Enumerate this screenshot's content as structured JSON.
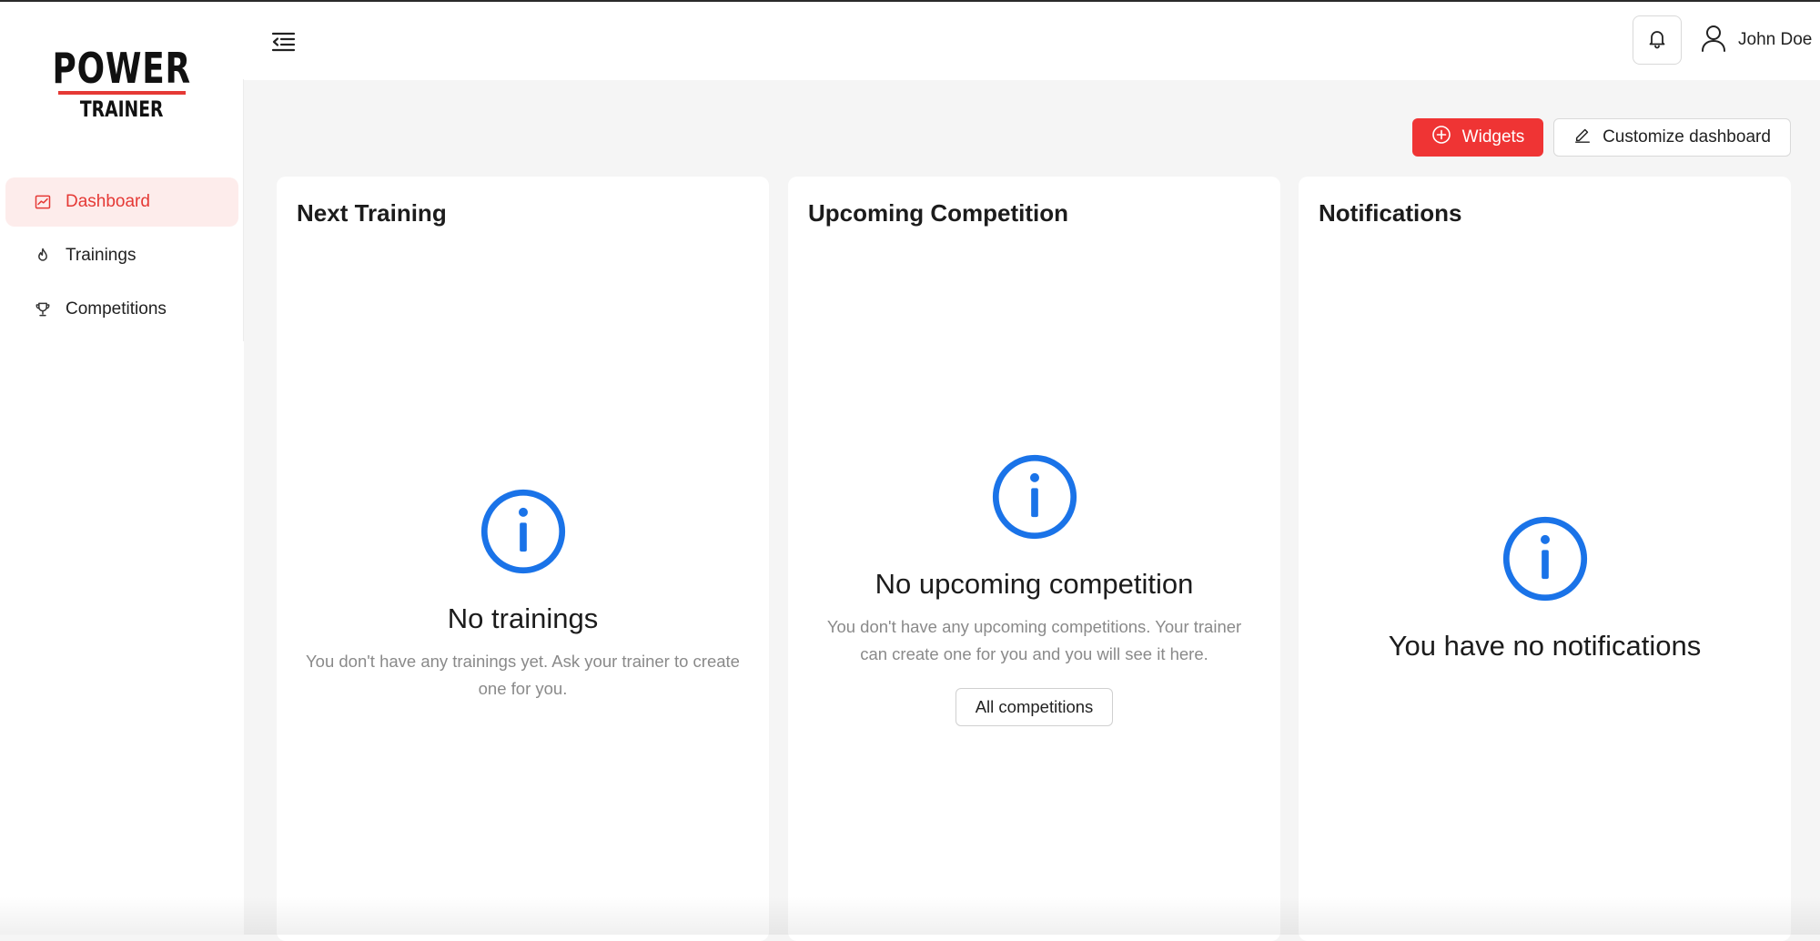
{
  "brand": {
    "line1": "POWER",
    "line2": "TRAINER"
  },
  "colors": {
    "accent": "#e53935",
    "info": "#1a73e8"
  },
  "sidebar": {
    "items": [
      {
        "label": "Dashboard",
        "icon": "chart-line-icon",
        "active": true
      },
      {
        "label": "Trainings",
        "icon": "flame-icon",
        "active": false
      },
      {
        "label": "Competitions",
        "icon": "trophy-icon",
        "active": false
      }
    ]
  },
  "header": {
    "user_name": "John Doe"
  },
  "toolbar": {
    "widgets_label": "Widgets",
    "customize_label": "Customize dashboard"
  },
  "cards": {
    "next_training": {
      "title": "Next Training",
      "empty_title": "No trainings",
      "empty_desc": "You don't have any trainings yet. Ask your trainer to create one for you."
    },
    "upcoming_competition": {
      "title": "Upcoming Competition",
      "empty_title": "No upcoming competition",
      "empty_desc": "You don't have any upcoming competitions. Your trainer can create one for you and you will see it here.",
      "button_label": "All competitions"
    },
    "notifications": {
      "title": "Notifications",
      "empty_title": "You have no notifications"
    }
  }
}
